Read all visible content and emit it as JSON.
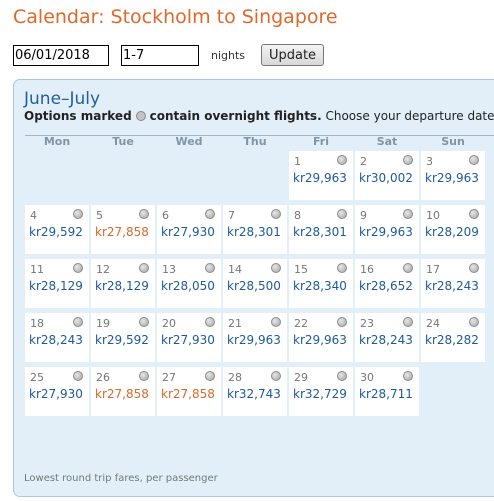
{
  "page_title": "Calendar: Stockholm to Singapore",
  "controls": {
    "date_value": "06/01/2018",
    "nights_value": "1-7",
    "nights_label": "nights",
    "update_label": "Update"
  },
  "calendar": {
    "month_label": "June–July",
    "subtitle_bold_1": "Options marked",
    "subtitle_bold_2": "contain overnight flights.",
    "subtitle_rest": "Choose your departure date",
    "weekdays": [
      "Mon",
      "Tue",
      "Wed",
      "Thu",
      "Fri",
      "Sat",
      "Sun"
    ],
    "days": [
      {
        "day": "1",
        "price": "kr29,963",
        "lowest": false
      },
      {
        "day": "2",
        "price": "kr30,002",
        "lowest": false
      },
      {
        "day": "3",
        "price": "kr29,963",
        "lowest": false
      },
      {
        "day": "4",
        "price": "kr29,592",
        "lowest": false
      },
      {
        "day": "5",
        "price": "kr27,858",
        "lowest": true
      },
      {
        "day": "6",
        "price": "kr27,930",
        "lowest": false
      },
      {
        "day": "7",
        "price": "kr28,301",
        "lowest": false
      },
      {
        "day": "8",
        "price": "kr28,301",
        "lowest": false
      },
      {
        "day": "9",
        "price": "kr29,963",
        "lowest": false
      },
      {
        "day": "10",
        "price": "kr28,209",
        "lowest": false
      },
      {
        "day": "11",
        "price": "kr28,129",
        "lowest": false
      },
      {
        "day": "12",
        "price": "kr28,129",
        "lowest": false
      },
      {
        "day": "13",
        "price": "kr28,050",
        "lowest": false
      },
      {
        "day": "14",
        "price": "kr28,500",
        "lowest": false
      },
      {
        "day": "15",
        "price": "kr28,340",
        "lowest": false
      },
      {
        "day": "16",
        "price": "kr28,652",
        "lowest": false
      },
      {
        "day": "17",
        "price": "kr28,243",
        "lowest": false
      },
      {
        "day": "18",
        "price": "kr28,243",
        "lowest": false
      },
      {
        "day": "19",
        "price": "kr29,592",
        "lowest": false
      },
      {
        "day": "20",
        "price": "kr27,930",
        "lowest": false
      },
      {
        "day": "21",
        "price": "kr29,963",
        "lowest": false
      },
      {
        "day": "22",
        "price": "kr29,963",
        "lowest": false
      },
      {
        "day": "23",
        "price": "kr28,243",
        "lowest": false
      },
      {
        "day": "24",
        "price": "kr28,282",
        "lowest": false
      },
      {
        "day": "25",
        "price": "kr27,930",
        "lowest": false
      },
      {
        "day": "26",
        "price": "kr27,858",
        "lowest": true
      },
      {
        "day": "27",
        "price": "kr27,858",
        "lowest": true
      },
      {
        "day": "28",
        "price": "kr32,743",
        "lowest": false
      },
      {
        "day": "29",
        "price": "kr32,729",
        "lowest": false
      },
      {
        "day": "30",
        "price": "kr28,711",
        "lowest": false
      }
    ],
    "footer_note": "Lowest round trip fares, per passenger"
  },
  "colors": {
    "title_orange": "#e0682a",
    "price_blue": "#1e5a9a",
    "lowest_price_orange": "#d8692b",
    "panel_bg": "#e2eff8"
  },
  "icons": {
    "overnight": "overnight-flight-icon"
  }
}
